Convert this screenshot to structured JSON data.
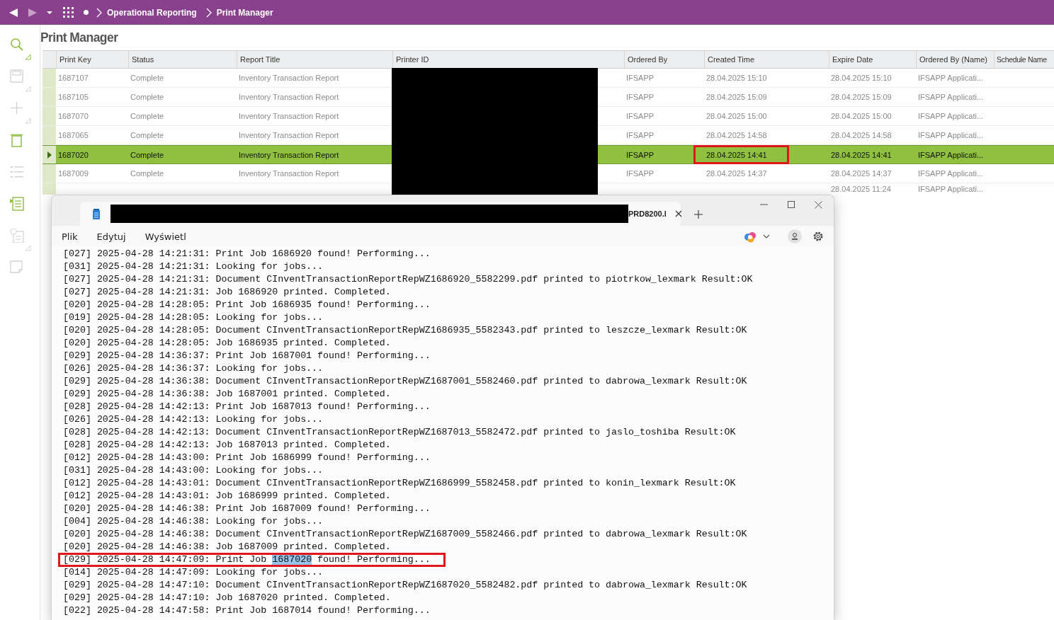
{
  "breadcrumb": [
    "Operational Reporting",
    "Print Manager"
  ],
  "page_title": "Print Manager",
  "sidebar": {
    "items": [
      {
        "kind": "search",
        "disabled": false,
        "menu": true
      },
      {
        "kind": "save",
        "disabled": true,
        "menu": true
      },
      {
        "kind": "add",
        "disabled": true,
        "menu": true
      },
      {
        "kind": "delete",
        "disabled": false,
        "menu": false
      },
      {
        "kind": "list",
        "disabled": true,
        "menu": false
      },
      {
        "kind": "details",
        "disabled": false,
        "menu": false
      },
      {
        "kind": "info",
        "disabled": true,
        "menu": true
      },
      {
        "kind": "page",
        "disabled": true,
        "menu": false
      }
    ]
  },
  "table": {
    "columns": [
      "Print Key",
      "Status",
      "Report Title",
      "Printer ID",
      "Ordered By",
      "Created Time",
      "Expire Date",
      "Ordered By (Name)",
      "Schedule Name"
    ],
    "rows": [
      {
        "print_key": "1687107",
        "status": "Complete",
        "report_title": "Inventory Transaction Report",
        "ordered_by": "IFSAPP",
        "annotated": false,
        "created_time": "28.04.2025 15:10",
        "expire_date": "28.04.2025 15:10",
        "ordered_by_name": "IFSAPP Applicati...",
        "selected": false
      },
      {
        "print_key": "1687105",
        "status": "Complete",
        "report_title": "Inventory Transaction Report",
        "ordered_by": "IFSAPP",
        "annotated": false,
        "created_time": "28.04.2025 15:09",
        "expire_date": "28.04.2025 15:09",
        "ordered_by_name": "IFSAPP Applicati...",
        "selected": false
      },
      {
        "print_key": "1687070",
        "status": "Complete",
        "report_title": "Inventory Transaction Report",
        "ordered_by": "IFSAPP",
        "annotated": false,
        "created_time": "28.04.2025 15:00",
        "expire_date": "28.04.2025 15:00",
        "ordered_by_name": "IFSAPP Applicati...",
        "selected": false
      },
      {
        "print_key": "1687065",
        "status": "Complete",
        "report_title": "Inventory Transaction Report",
        "ordered_by": "IFSAPP",
        "annotated": false,
        "created_time": "28.04.2025 14:58",
        "expire_date": "28.04.2025 14:58",
        "ordered_by_name": "IFSAPP Applicati...",
        "selected": false
      },
      {
        "print_key": "1687020",
        "status": "Complete",
        "report_title": "Inventory Transaction Report",
        "ordered_by": "IFSAPP",
        "annotated": true,
        "created_time": "28.04.2025 14:41",
        "expire_date": "28.04.2025 14:41",
        "ordered_by_name": "IFSAPP Applicati...",
        "selected": true
      },
      {
        "print_key": "1687009",
        "status": "Complete",
        "report_title": "Inventory Transaction Report",
        "ordered_by": "IFSAPP",
        "annotated": false,
        "created_time": "28.04.2025 14:37",
        "expire_date": "28.04.2025 14:37",
        "ordered_by_name": "IFSAPP Applicati...",
        "selected": false
      },
      {
        "annotated": false,
        "expire_date": "28.04.2025 11:24",
        "ordered_by_name": "IFSAPP Applicati...",
        "selected": false
      }
    ]
  },
  "notepad": {
    "tab_title": "PRD8200.l",
    "menu": [
      "Plik",
      "Edytuj",
      "Wyświetl"
    ],
    "lines": [
      {
        "segments": [
          {
            "text": "[027] 2025-04-28 14:21:31: Print Job 1686920 found! Performing...",
            "selected": false
          }
        ]
      },
      {
        "segments": [
          {
            "text": "[031] 2025-04-28 14:21:31: Looking for jobs...",
            "selected": false
          }
        ]
      },
      {
        "segments": [
          {
            "text": "[027] 2025-04-28 14:21:31: Document CInventTransactionReportRepWZ1686920_5582299.pdf printed to piotrkow_lexmark Result:OK",
            "selected": false
          }
        ]
      },
      {
        "segments": [
          {
            "text": "[027] 2025-04-28 14:21:31: Job 1686920 printed. Completed.",
            "selected": false
          }
        ]
      },
      {
        "segments": [
          {
            "text": "[020] 2025-04-28 14:28:05: Print Job 1686935 found! Performing...",
            "selected": false
          }
        ]
      },
      {
        "segments": [
          {
            "text": "[019] 2025-04-28 14:28:05: Looking for jobs...",
            "selected": false
          }
        ]
      },
      {
        "segments": [
          {
            "text": "[020] 2025-04-28 14:28:05: Document CInventTransactionReportRepWZ1686935_5582343.pdf printed to leszcze_lexmark Result:OK",
            "selected": false
          }
        ]
      },
      {
        "segments": [
          {
            "text": "[020] 2025-04-28 14:28:05: Job 1686935 printed. Completed.",
            "selected": false
          }
        ]
      },
      {
        "segments": [
          {
            "text": "[029] 2025-04-28 14:36:37: Print Job 1687001 found! Performing...",
            "selected": false
          }
        ]
      },
      {
        "segments": [
          {
            "text": "[026] 2025-04-28 14:36:37: Looking for jobs...",
            "selected": false
          }
        ]
      },
      {
        "segments": [
          {
            "text": "[029] 2025-04-28 14:36:38: Document CInventTransactionReportRepWZ1687001_5582460.pdf printed to dabrowa_lexmark Result:OK",
            "selected": false
          }
        ]
      },
      {
        "segments": [
          {
            "text": "[029] 2025-04-28 14:36:38: Job 1687001 printed. Completed.",
            "selected": false
          }
        ]
      },
      {
        "segments": [
          {
            "text": "[028] 2025-04-28 14:42:13: Print Job 1687013 found! Performing...",
            "selected": false
          }
        ]
      },
      {
        "segments": [
          {
            "text": "[026] 2025-04-28 14:42:13: Looking for jobs...",
            "selected": false
          }
        ]
      },
      {
        "segments": [
          {
            "text": "[028] 2025-04-28 14:42:13: Document CInventTransactionReportRepWZ1687013_5582472.pdf printed to jaslo_toshiba Result:OK",
            "selected": false
          }
        ]
      },
      {
        "segments": [
          {
            "text": "[028] 2025-04-28 14:42:13: Job 1687013 printed. Completed.",
            "selected": false
          }
        ]
      },
      {
        "segments": [
          {
            "text": "[012] 2025-04-28 14:43:00: Print Job 1686999 found! Performing...",
            "selected": false
          }
        ]
      },
      {
        "segments": [
          {
            "text": "[031] 2025-04-28 14:43:00: Looking for jobs...",
            "selected": false
          }
        ]
      },
      {
        "segments": [
          {
            "text": "[012] 2025-04-28 14:43:01: Document CInventTransactionReportRepWZ1686999_5582458.pdf printed to konin_lexmark Result:OK",
            "selected": false
          }
        ]
      },
      {
        "segments": [
          {
            "text": "[012] 2025-04-28 14:43:01: Job 1686999 printed. Completed.",
            "selected": false
          }
        ]
      },
      {
        "segments": [
          {
            "text": "[020] 2025-04-28 14:46:38: Print Job 1687009 found! Performing...",
            "selected": false
          }
        ]
      },
      {
        "segments": [
          {
            "text": "[004] 2025-04-28 14:46:38: Looking for jobs...",
            "selected": false
          }
        ]
      },
      {
        "segments": [
          {
            "text": "[020] 2025-04-28 14:46:38: Document CInventTransactionReportRepWZ1687009_5582466.pdf printed to dabrowa_lexmark Result:OK",
            "selected": false
          }
        ]
      },
      {
        "segments": [
          {
            "text": "[020] 2025-04-28 14:46:38: Job 1687009 printed. Completed.",
            "selected": false
          }
        ]
      },
      {
        "segments": [
          {
            "text": "[029] 2025-04-28 14:47:09: Print Job ",
            "selected": false
          },
          {
            "text": "1687020",
            "selected": true
          },
          {
            "text": " found! Performing...",
            "selected": false
          }
        ]
      },
      {
        "segments": [
          {
            "text": "[014] 2025-04-28 14:47:09: Looking for jobs...",
            "selected": false
          }
        ]
      },
      {
        "segments": [
          {
            "text": "[029] 2025-04-28 14:47:10: Document CInventTransactionReportRepWZ1687020_5582482.pdf printed to dabrowa_lexmark Result:OK",
            "selected": false
          }
        ]
      },
      {
        "segments": [
          {
            "text": "[029] 2025-04-28 14:47:10: Job 1687020 printed. Completed.",
            "selected": false
          }
        ]
      },
      {
        "segments": [
          {
            "text": "[022] 2025-04-28 14:47:58: Print Job 1687014 found! Performing...",
            "selected": false
          }
        ]
      }
    ]
  }
}
